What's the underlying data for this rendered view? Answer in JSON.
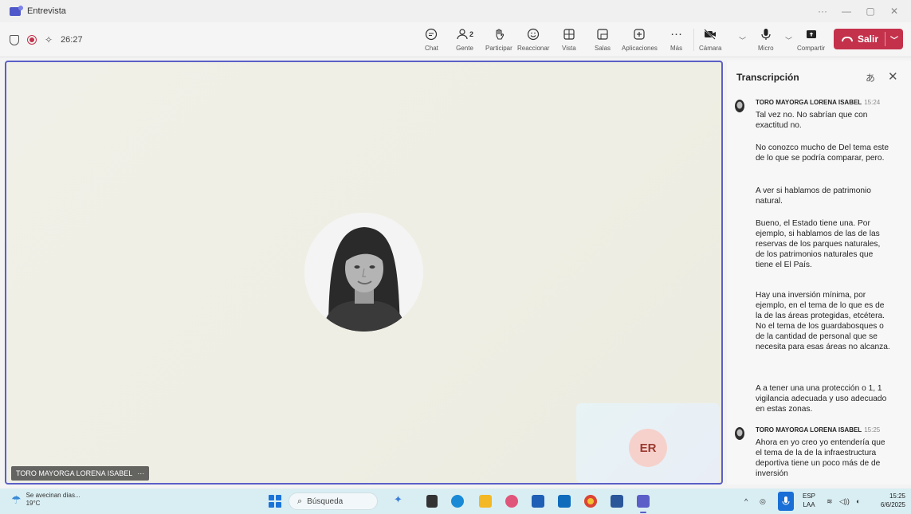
{
  "window": {
    "title": "Entrevista",
    "controls": [
      "···",
      "—",
      "▢",
      "✕"
    ]
  },
  "meeting": {
    "timer": "26:27",
    "toolbar": [
      {
        "id": "chat",
        "label": "Chat",
        "icon": "chat-icon"
      },
      {
        "id": "people",
        "label": "Gente",
        "icon": "people-icon",
        "count": "2"
      },
      {
        "id": "raise",
        "label": "Participar",
        "icon": "raise-hand-icon"
      },
      {
        "id": "react",
        "label": "Reaccionar",
        "icon": "smiley-icon"
      },
      {
        "id": "view",
        "label": "Vista",
        "icon": "view-grid-icon"
      },
      {
        "id": "rooms",
        "label": "Salas",
        "icon": "breakout-rooms-icon"
      },
      {
        "id": "apps",
        "label": "Aplicaciones",
        "icon": "plus-box-icon"
      },
      {
        "id": "more",
        "label": "Más",
        "icon": "more-dots-icon"
      },
      {
        "id": "camera",
        "label": "Cámara",
        "icon": "camera-off-icon"
      },
      {
        "id": "mic",
        "label": "Micro",
        "icon": "microphone-icon"
      },
      {
        "id": "share",
        "label": "Compartir",
        "icon": "share-screen-icon"
      }
    ],
    "leave_label": "Salir",
    "colors": {
      "accent": "#5b5fc7",
      "leave": "#c4314b"
    }
  },
  "stage": {
    "speaker_name": "TORO MAYORGA LORENA ISABEL",
    "name_tag_more": "···",
    "self_initials": "ER"
  },
  "transcript": {
    "title": "Transcripción",
    "entries": [
      {
        "speaker": "TORO MAYORGA LORENA ISABEL",
        "time": "15:24",
        "paragraphs": [
          "Tal vez no. No sabrían que con exactitud no.",
          "No conozco mucho de Del tema este de lo que se podría comparar, pero.",
          "A ver si hablamos de patrimonio natural.",
          "Bueno, el Estado tiene una. Por ejemplo, si hablamos de las de las reservas de los parques naturales, de los patrimonios naturales que tiene el El País.",
          "Hay una inversión mínima, por ejemplo, en el tema de lo que es de la de las áreas protegidas, etcétera. No el tema de los guardabosques o de la cantidad de personal que se necesita para esas áreas no alcanza.",
          "A a tener una una protección o 1, 1 vigilancia adecuada y uso adecuado en estas zonas."
        ]
      },
      {
        "speaker": "TORO MAYORGA LORENA ISABEL",
        "time": "15:25",
        "paragraphs": [
          "Ahora en yo creo yo entendería que el tema de la de la infraestructura deportiva tiene un poco más de de inversión"
        ]
      }
    ]
  },
  "taskbar": {
    "weather_text": "Se avecinan días...",
    "temperature": "19°C",
    "search_placeholder": "Búsqueda",
    "language": "ESP",
    "language_sub": "LAA",
    "time": "15:25",
    "date": "6/6/2025"
  }
}
